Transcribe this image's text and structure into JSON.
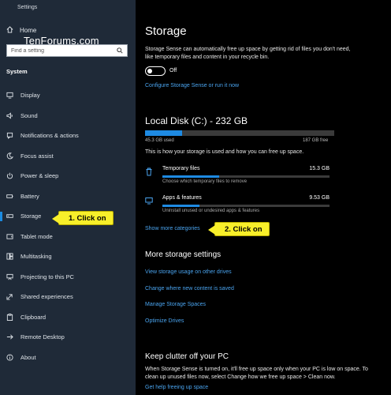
{
  "window": {
    "title": "Settings"
  },
  "watermark": "TenForums.com",
  "sidebar": {
    "home_label": "Home",
    "search_placeholder": "Find a setting",
    "section_label": "System",
    "items": [
      {
        "label": "Display",
        "icon": "monitor-icon"
      },
      {
        "label": "Sound",
        "icon": "speaker-icon"
      },
      {
        "label": "Notifications & actions",
        "icon": "notification-icon"
      },
      {
        "label": "Focus assist",
        "icon": "moon-icon"
      },
      {
        "label": "Power & sleep",
        "icon": "power-icon"
      },
      {
        "label": "Battery",
        "icon": "battery-icon"
      },
      {
        "label": "Storage",
        "icon": "storage-icon"
      },
      {
        "label": "Tablet mode",
        "icon": "tablet-icon"
      },
      {
        "label": "Multitasking",
        "icon": "multitasking-icon"
      },
      {
        "label": "Projecting to this PC",
        "icon": "projector-icon"
      },
      {
        "label": "Shared experiences",
        "icon": "shared-icon"
      },
      {
        "label": "Clipboard",
        "icon": "clipboard-icon"
      },
      {
        "label": "Remote Desktop",
        "icon": "remote-icon"
      },
      {
        "label": "About",
        "icon": "info-icon"
      }
    ],
    "selected_index": 6
  },
  "callouts": {
    "first": "1. Click on",
    "second": "2. Click on"
  },
  "main": {
    "title": "Storage",
    "sense_description": "Storage Sense can automatically free up space by getting rid of files you don't need, like temporary files and content in your recycle bin.",
    "toggle_label": "Off",
    "configure_link": "Configure Storage Sense or run it now",
    "disk": {
      "title": "Local Disk (C:) - 232 GB",
      "used": "45.3 GB used",
      "free": "187 GB free",
      "used_fraction": 0.195,
      "description": "This is how your storage is used and how you can free up space."
    },
    "categories": [
      {
        "name": "Temporary files",
        "size": "15.3 GB",
        "description": "Choose which temporary files to remove",
        "fraction": 0.34,
        "icon": "trash-icon"
      },
      {
        "name": "Apps & features",
        "size": "9.53 GB",
        "description": "Uninstall unused or undesired apps & features",
        "fraction": 0.22,
        "icon": "apps-icon"
      }
    ],
    "show_more_link": "Show more categories",
    "more_settings_title": "More storage settings",
    "more_settings_links": [
      "View storage usage on other drives",
      "Change where new content is saved",
      "Manage Storage Spaces",
      "Optimize Drives"
    ],
    "clutter_title": "Keep clutter off your PC",
    "clutter_description": "When Storage Sense is turned on, it'll free up space only when your PC is low on space. To clean up unused files now, select Change how we free up space > Clean now.",
    "help_link": "Get help freeing up space"
  },
  "colors": {
    "accent": "#1e8ae2",
    "link": "#4aa4ef",
    "callout": "#f8ef2a",
    "sidebar_bg": "#1f2a38"
  }
}
